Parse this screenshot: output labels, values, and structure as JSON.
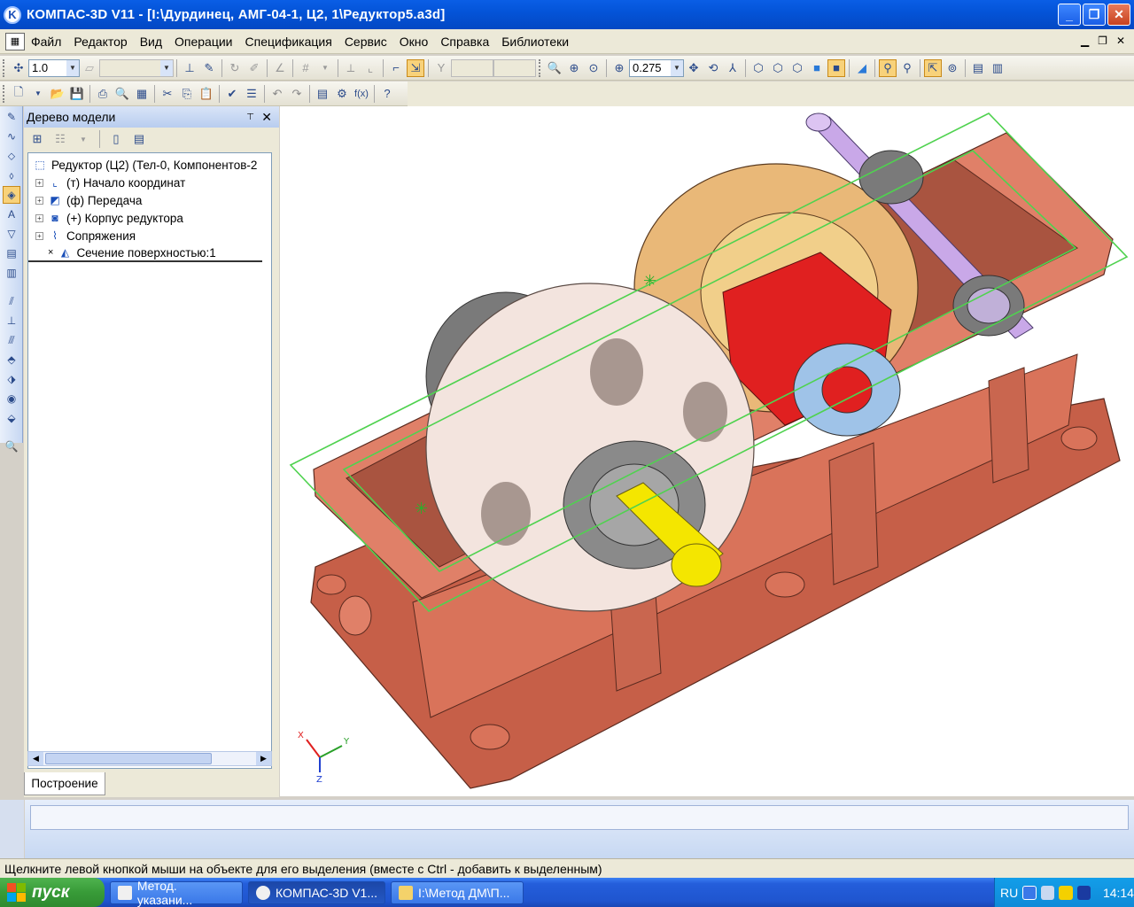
{
  "window": {
    "title": "КОМПАС-3D V11 - [I:\\Дурдинец, АМГ-04-1, Ц2, 1\\Редуктор5.a3d]",
    "app_logo": "K"
  },
  "menu": [
    "Файл",
    "Редактор",
    "Вид",
    "Операции",
    "Спецификация",
    "Сервис",
    "Окно",
    "Справка",
    "Библиотеки"
  ],
  "toolbar": {
    "step_value": "1.0",
    "zoom_value": "0.275"
  },
  "tree": {
    "header": "Дерево модели",
    "root": "Редуктор (Ц2) (Тел-0, Компонентов-2",
    "items": [
      {
        "label": "(т) Начало координат",
        "icon": "origin-icon"
      },
      {
        "label": "(ф) Передача",
        "icon": "assembly-icon"
      },
      {
        "label": "(+) Корпус редуктора",
        "icon": "part-icon"
      },
      {
        "label": "Сопряжения",
        "icon": "mates-icon"
      },
      {
        "label": "Сечение поверхностью:1",
        "icon": "section-icon"
      }
    ],
    "tab": "Построение"
  },
  "axes": {
    "x": "X",
    "y": "Y",
    "z": "Z"
  },
  "status": "Щелкните левой кнопкой мыши на объекте для его выделения (вместе с Ctrl - добавить к выделенным)",
  "taskbar": {
    "start": "пуск",
    "tasks": [
      "Метод. указани...",
      "КОМПАС-3D V1...",
      "I:\\Метод ДМ\\П..."
    ],
    "lang": "RU",
    "time": "14:14"
  },
  "colors": {
    "housing": "#d9735a",
    "gear_big": "#f3e4de",
    "gear_back": "#e9b878",
    "pinion": "#e02020",
    "shaft_yellow": "#f4e600",
    "shaft_violet": "#c9a8e8",
    "section_plane": "#4fd24f"
  }
}
